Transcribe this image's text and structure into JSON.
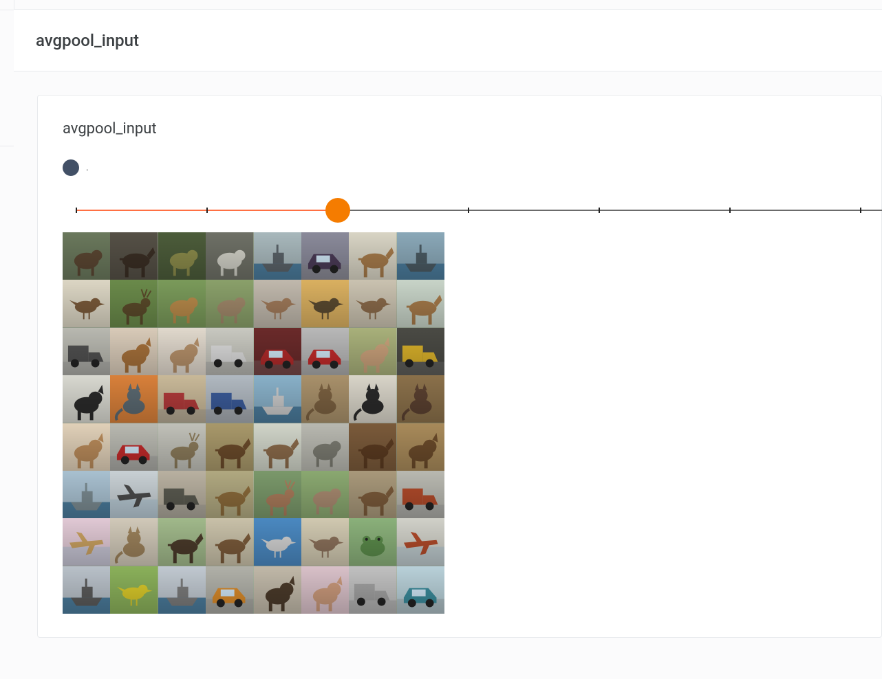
{
  "outer_header": {
    "title": "avgpool_input"
  },
  "card": {
    "title": "avgpool_input",
    "legend_label": ".",
    "legend_color": "#425066",
    "slider": {
      "min": 0,
      "max": 6,
      "value": 2,
      "accent": "#F57C00",
      "track_color": "#6b6b6b",
      "fill_color": "#ff7043",
      "fill_fraction": 0.333,
      "ticks_fraction": [
        0.0,
        0.167,
        0.333,
        0.5,
        0.667,
        0.833,
        1.0
      ]
    },
    "grid": {
      "rows": 8,
      "cols": 8,
      "cells": [
        {
          "bg": "#6a785c",
          "sh": "animal",
          "fg": "#5a4632"
        },
        {
          "bg": "#555046",
          "sh": "horse",
          "fg": "#3a2e24"
        },
        {
          "bg": "#4c5c3a",
          "sh": "animal",
          "fg": "#8a8a4a"
        },
        {
          "bg": "#6e7066",
          "sh": "animal",
          "fg": "#cfcfc5"
        },
        {
          "bg": "#a8b8bc",
          "sh": "ship",
          "fg": "#5a6268"
        },
        {
          "bg": "#8a8a9a",
          "sh": "car",
          "fg": "#4a3a56"
        },
        {
          "bg": "#d8d4c4",
          "sh": "horse",
          "fg": "#a57a4a"
        },
        {
          "bg": "#8aa8b8",
          "sh": "ship",
          "fg": "#4a5a62"
        },
        {
          "bg": "#dcd6c4",
          "sh": "bird",
          "fg": "#7a5a3a"
        },
        {
          "bg": "#6a8a4a",
          "sh": "deer",
          "fg": "#5a4a2a"
        },
        {
          "bg": "#7a9a5a",
          "sh": "animal",
          "fg": "#b88a4a"
        },
        {
          "bg": "#8aa06a",
          "sh": "animal",
          "fg": "#a0886a"
        },
        {
          "bg": "#c0b8ac",
          "sh": "bird",
          "fg": "#a07a5a"
        },
        {
          "bg": "#dab060",
          "sh": "bird",
          "fg": "#5a4a30"
        },
        {
          "bg": "#cac2b0",
          "sh": "bird",
          "fg": "#8a6a4a"
        },
        {
          "bg": "#c8d4c8",
          "sh": "horse",
          "fg": "#a57a4a"
        },
        {
          "bg": "#b8b8b0",
          "sh": "truck",
          "fg": "#505050"
        },
        {
          "bg": "#d8cab8",
          "sh": "dog",
          "fg": "#a5703a"
        },
        {
          "bg": "#e0d8cc",
          "sh": "dog",
          "fg": "#b5906a"
        },
        {
          "bg": "#c8c8c0",
          "sh": "truck",
          "fg": "#dadada"
        },
        {
          "bg": "#6a2a2a",
          "sh": "car",
          "fg": "#b02a2a"
        },
        {
          "bg": "#b8b8b8",
          "sh": "car",
          "fg": "#c02a2a"
        },
        {
          "bg": "#a8b07a",
          "sh": "dog",
          "fg": "#c8a07a"
        },
        {
          "bg": "#4a4a44",
          "sh": "truck",
          "fg": "#d8b02a"
        },
        {
          "bg": "#d8d8d0",
          "sh": "dog",
          "fg": "#2a2a2a"
        },
        {
          "bg": "#d8803a",
          "sh": "cat",
          "fg": "#5a6870"
        },
        {
          "bg": "#c8b898",
          "sh": "truck",
          "fg": "#b03a3a"
        },
        {
          "bg": "#b0b8c0",
          "sh": "truck",
          "fg": "#3a5a98"
        },
        {
          "bg": "#88b0c8",
          "sh": "ship",
          "fg": "#c8c8c8"
        },
        {
          "bg": "#a8906a",
          "sh": "cat",
          "fg": "#7a6040"
        },
        {
          "bg": "#d8d4c8",
          "sh": "cat",
          "fg": "#2a2a2a"
        },
        {
          "bg": "#8a704a",
          "sh": "cat",
          "fg": "#5a4030"
        },
        {
          "bg": "#e0d0b8",
          "sh": "dog",
          "fg": "#b88a5a"
        },
        {
          "bg": "#b8b8b0",
          "sh": "car",
          "fg": "#c02a2a"
        },
        {
          "bg": "#c0c0b8",
          "sh": "deer",
          "fg": "#8a7a5a"
        },
        {
          "bg": "#a8986a",
          "sh": "horse",
          "fg": "#6a4a2a"
        },
        {
          "bg": "#d0d4c8",
          "sh": "horse",
          "fg": "#8a6a4a"
        },
        {
          "bg": "#b8b8b0",
          "sh": "animal",
          "fg": "#7a7a70"
        },
        {
          "bg": "#7a5a3a",
          "sh": "horse",
          "fg": "#5a3a20"
        },
        {
          "bg": "#a88a5a",
          "sh": "dog",
          "fg": "#6a4a2a"
        },
        {
          "bg": "#a8c0d0",
          "sh": "ship",
          "fg": "#7a8a90"
        },
        {
          "bg": "#c8d0d4",
          "sh": "plane",
          "fg": "#4a4a4a"
        },
        {
          "bg": "#b8b0a0",
          "sh": "truck",
          "fg": "#5a5a50"
        },
        {
          "bg": "#b0a880",
          "sh": "horse",
          "fg": "#8a6a3a"
        },
        {
          "bg": "#7a986a",
          "sh": "deer",
          "fg": "#a87a5a"
        },
        {
          "bg": "#8aa870",
          "sh": "animal",
          "fg": "#a88a70"
        },
        {
          "bg": "#a8987a",
          "sh": "horse",
          "fg": "#7a5a3a"
        },
        {
          "bg": "#b8b8b0",
          "sh": "truck",
          "fg": "#b04a2a"
        },
        {
          "bg": "#e0c8d4",
          "sh": "plane",
          "fg": "#c8a060"
        },
        {
          "bg": "#d0c8b8",
          "sh": "cat",
          "fg": "#9a805a"
        },
        {
          "bg": "#a0b88a",
          "sh": "horse",
          "fg": "#4a3a2a"
        },
        {
          "bg": "#c8c0a8",
          "sh": "horse",
          "fg": "#7a5a3a"
        },
        {
          "bg": "#4a88c0",
          "sh": "bird",
          "fg": "#d0d0d0"
        },
        {
          "bg": "#d0c8b0",
          "sh": "bird",
          "fg": "#8a705a"
        },
        {
          "bg": "#8ab07a",
          "sh": "frog",
          "fg": "#5a8a4a"
        },
        {
          "bg": "#d0d0c8",
          "sh": "plane",
          "fg": "#b04a2a"
        },
        {
          "bg": "#b8c0c8",
          "sh": "ship",
          "fg": "#5a5a5a"
        },
        {
          "bg": "#8ab05a",
          "sh": "bird",
          "fg": "#d8c82a"
        },
        {
          "bg": "#c0c8d0",
          "sh": "ship",
          "fg": "#7a7a7a"
        },
        {
          "bg": "#b0b0a8",
          "sh": "car",
          "fg": "#d88a2a"
        },
        {
          "bg": "#c0b8a8",
          "sh": "dog",
          "fg": "#4a3a2a"
        },
        {
          "bg": "#d8c0c8",
          "sh": "dog",
          "fg": "#c8987a"
        },
        {
          "bg": "#c0c0c0",
          "sh": "truck",
          "fg": "#a0a0a0"
        },
        {
          "bg": "#b8d0d8",
          "sh": "car",
          "fg": "#3a8a9a"
        }
      ]
    }
  }
}
